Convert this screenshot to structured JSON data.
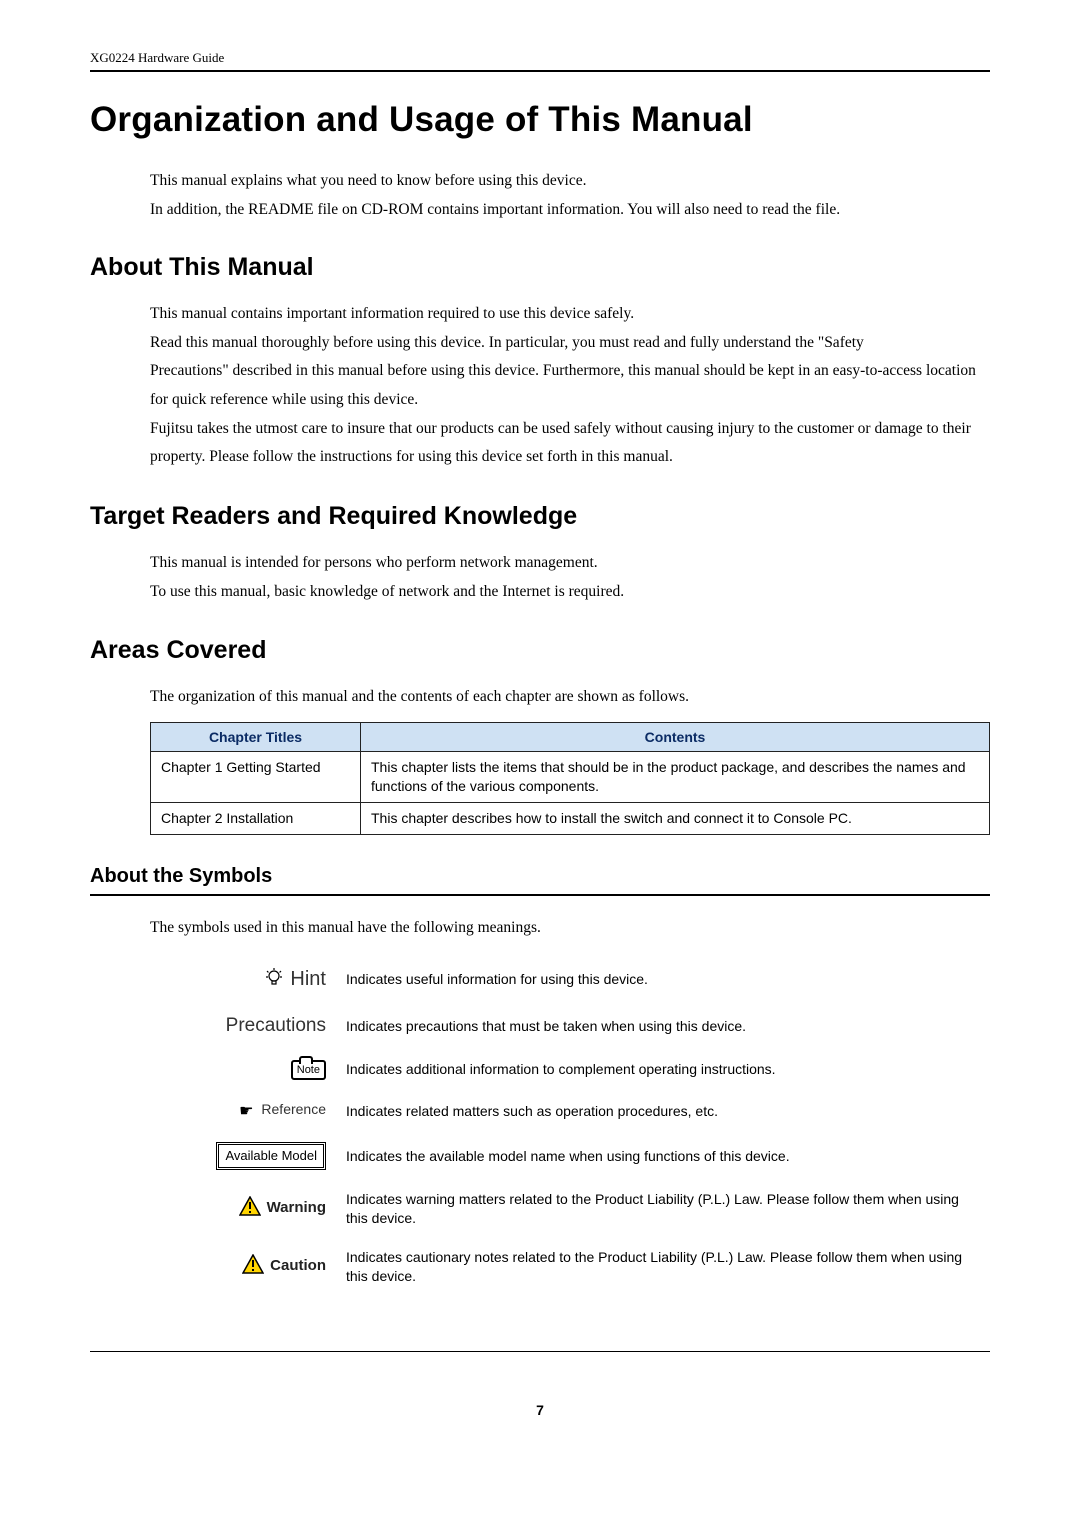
{
  "running_head": "XG0224 Hardware Guide",
  "title": "Organization and Usage of This Manual",
  "intro_p1": "This manual explains what you need to know before using this device.",
  "intro_p2": "In addition, the README file on CD-ROM contains important information. You will also need to read the file.",
  "sect_about": {
    "heading": "About This Manual",
    "p1": "This manual contains important information required to use this device safely.",
    "p2": "Read this manual thoroughly before using this device. In particular, you must read and fully understand the \"Safety",
    "p3": "Precautions\" described in this manual before using this device. Furthermore, this manual should be kept in an easy-to-access location for quick reference while using this device.",
    "p4": "Fujitsu takes the utmost care to insure that our products can be used safely without causing injury to the customer or damage to their property. Please follow the instructions for using this device set forth in this manual."
  },
  "sect_target": {
    "heading": "Target Readers and Required Knowledge",
    "p1": "This manual is intended for persons who perform network management.",
    "p2": "To use this manual, basic knowledge of network and the Internet is required."
  },
  "sect_areas": {
    "heading": "Areas Covered",
    "p1": "The organization of this manual and the contents of each chapter are shown as follows.",
    "th1": "Chapter Titles",
    "th2": "Contents",
    "rows": [
      {
        "title": "Chapter 1 Getting Started",
        "desc": "This chapter lists the items that should be in the product package, and describes the names and functions of the various components."
      },
      {
        "title": "Chapter 2 Installation",
        "desc": "This chapter describes how to install the switch and connect it to Console PC."
      }
    ]
  },
  "sect_symbols": {
    "heading": "About the Symbols",
    "p1": "The symbols used in this manual have the following meanings.",
    "items": [
      {
        "label": "Hint",
        "desc": "Indicates useful information for using this device."
      },
      {
        "label": "Precautions",
        "desc": "Indicates precautions that must be taken when using this device."
      },
      {
        "label": "Note",
        "desc": "Indicates additional information to complement operating instructions."
      },
      {
        "label": "Reference",
        "desc": "Indicates related matters such as operation procedures, etc."
      },
      {
        "label": "Available Model",
        "desc": "Indicates the available model name when using functions of this device."
      },
      {
        "label": "Warning",
        "desc": "Indicates warning matters related to the Product Liability (P.L.) Law. Please follow them when using this device."
      },
      {
        "label": "Caution",
        "desc": "Indicates cautionary notes related to the Product Liability (P.L.) Law. Please follow them when using this device."
      }
    ]
  },
  "page_number": "7"
}
